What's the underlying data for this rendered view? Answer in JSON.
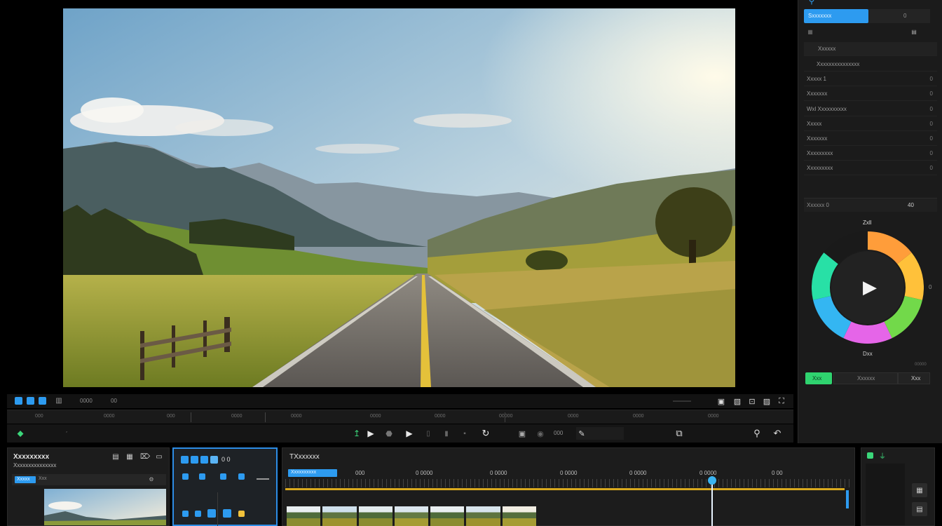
{
  "viewer": {
    "scene": "landscape-photo"
  },
  "inspector": {
    "top_tab": "Sxxxxxxx",
    "top_tab_value": "0",
    "rows": [
      {
        "label": "Xxxxxx",
        "value": ""
      },
      {
        "label": "Xxxxxxxxxxxxxxx",
        "value": ""
      },
      {
        "label": "Xxxxx 1",
        "value": "0"
      },
      {
        "label": "Xxxxxxx",
        "value": "0"
      },
      {
        "label": "Wxl Xxxxxxxxxx",
        "value": "0"
      },
      {
        "label": "Xxxxx",
        "value": "0"
      },
      {
        "label": "Xxxxxxx",
        "value": "0"
      },
      {
        "label": "Xxxxxxxxx",
        "value": "0"
      },
      {
        "label": "Xxxxxxxxx",
        "value": "0"
      }
    ],
    "section_label": "Xxxxxx 0",
    "section_value": "40",
    "wheel_top_label": "Zxll",
    "wheel_bottom_label": "Dxx",
    "wheel_right_label": "0",
    "wheel_small_label": "00000",
    "btn_green": "Xxx",
    "btn_middle": "Xxxxxx",
    "btn_right": "Xxx"
  },
  "toolstrip": {
    "left_label": "0000",
    "left_label2": "00"
  },
  "ruler": {
    "labels": [
      "000",
      "0000",
      "000",
      "0000",
      "0000",
      "0000",
      "0000",
      "00000",
      "0000",
      "0000",
      "0000"
    ]
  },
  "transport": {
    "speed_label": "000"
  },
  "media": {
    "title": "Xxxxxxxxx",
    "subtitle": "Xxxxxxxxxxxxxxx",
    "chip": "Xxxxx",
    "chip2": "Xxx"
  },
  "effects": {
    "header": "0 0"
  },
  "timeline": {
    "title": "TXxxxxxx",
    "marker": "Xxxxxxxxxx",
    "ticks": [
      "000",
      "0 0000",
      "0 0000",
      "0 0000",
      "0 0000",
      "0 0000",
      "0 00"
    ]
  },
  "colors": {
    "accent": "#2d9bf0",
    "playhead": "#3ab4f2",
    "track": "#d9a91e",
    "wheel": [
      "#ff9d3a",
      "#ffc13a",
      "#72d94a",
      "#e565e8",
      "#34b6f2",
      "#28e0a6",
      "#1a1a1a"
    ]
  }
}
